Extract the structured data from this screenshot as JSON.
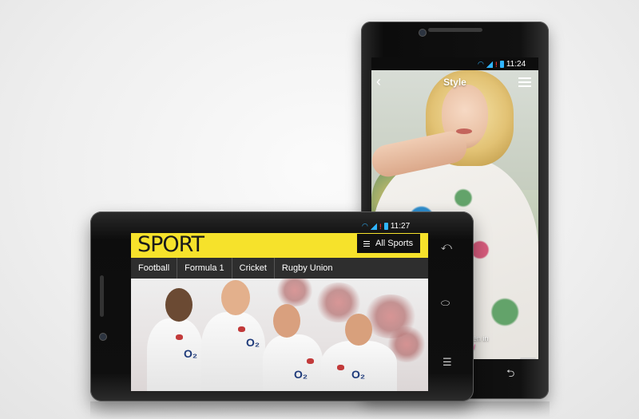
{
  "back_phone": {
    "status_time": "11:24",
    "screen_title": "Style",
    "caption_line1": "rs",
    "caption_line2": "allen in",
    "caption_link": "co/",
    "plus_label": "+"
  },
  "front_phone": {
    "status_time": "11:27",
    "logo": "SPORT",
    "menu_button_label": "All Sports",
    "tabs": [
      "Football",
      "Formula 1",
      "Cricket",
      "Rugby Union"
    ]
  },
  "icons": {
    "back": "chevron-left-icon",
    "menu": "hamburger-menu-icon",
    "add": "plus-icon",
    "nav_back": "nav-back-icon",
    "nav_home": "nav-home-icon",
    "nav_recent": "nav-recent-icon"
  },
  "colors": {
    "sport_accent": "#f6e22b",
    "tab_bar": "#2e2e2e",
    "status_icons": "#30b5ff",
    "phone_body": "#0f0f0f"
  }
}
